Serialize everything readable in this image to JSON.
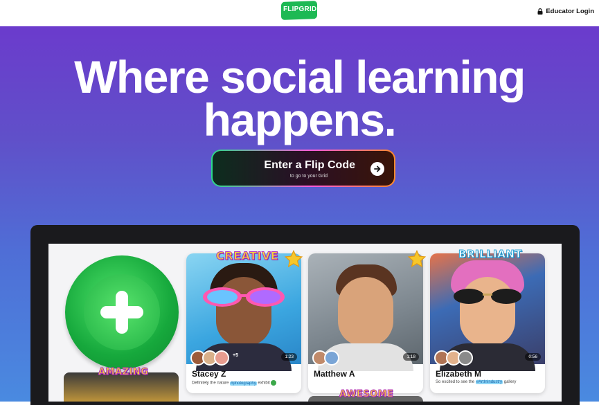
{
  "header": {
    "logo_text": "FLIPGRID",
    "login_label": "Educator Login"
  },
  "hero": {
    "headline_line1": "Where social learning",
    "headline_line2": "happens.",
    "cta_title": "Enter a Flip Code",
    "cta_subtitle": "to go to your Grid"
  },
  "cards": [
    {
      "sticker": "CREATIVE",
      "name": "Stacey Z",
      "caption_before": "Definitely the nature ",
      "caption_tag": "#photography",
      "caption_after": " exhibit",
      "extra_count": "+5",
      "duration": "1:23"
    },
    {
      "name": "Matthew A",
      "duration": "1:18"
    },
    {
      "sticker": "BRILLIANT",
      "name": "Elizabeth M",
      "caption_before": "So excited to see the ",
      "caption_tag": "#ArtInIndustry",
      "caption_after": " gallery",
      "duration": "0:56"
    }
  ],
  "stickers_bottom": {
    "left": "AMAZING",
    "middle": "AWESOME"
  },
  "colors": {
    "brand_green": "#1db954",
    "hero_top": "#6b3bcc",
    "hero_bottom": "#4a8ae0",
    "tag_bg": "#8fd7f7"
  }
}
